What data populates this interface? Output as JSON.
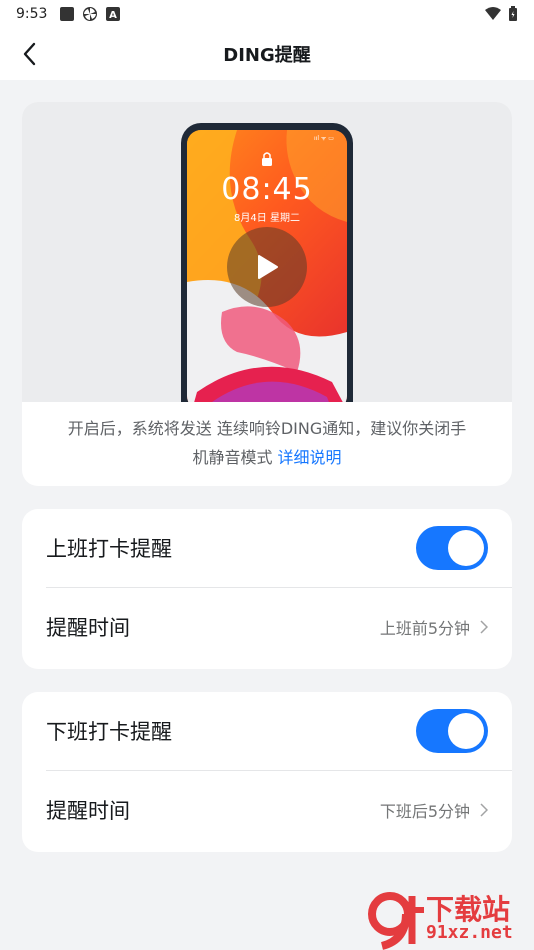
{
  "status_bar": {
    "time": "9:53",
    "icons": [
      "square-icon",
      "pinwheel-icon",
      "keyboard-a-icon"
    ],
    "right_icons": [
      "wifi-icon",
      "battery-icon"
    ]
  },
  "nav": {
    "title": "DING提醒",
    "back_icon": "chevron-left-icon"
  },
  "video_card": {
    "phone_time": "08:45",
    "phone_date": "8月4日 星期二",
    "description": "开启后，系统将发送 连续响铃DING通知，建议你关闭手机静音模式",
    "description_line1": "开启后，系统将发送 连续响铃DING通知，建议你关闭手",
    "description_line2": "机静音模式",
    "link": "详细说明"
  },
  "clock_in": {
    "label": "上班打卡提醒",
    "toggle_on": true,
    "time_label": "提醒时间",
    "time_value": "上班前5分钟"
  },
  "clock_out": {
    "label": "下班打卡提醒",
    "toggle_on": true,
    "time_label": "提醒时间",
    "time_value": "下班后5分钟"
  },
  "watermark": {
    "top": "下载站",
    "bottom": "91xz.net",
    "logo": "9f"
  },
  "colors": {
    "accent": "#1677ff",
    "background": "#f2f3f5",
    "watermark": "#e43c3f"
  }
}
